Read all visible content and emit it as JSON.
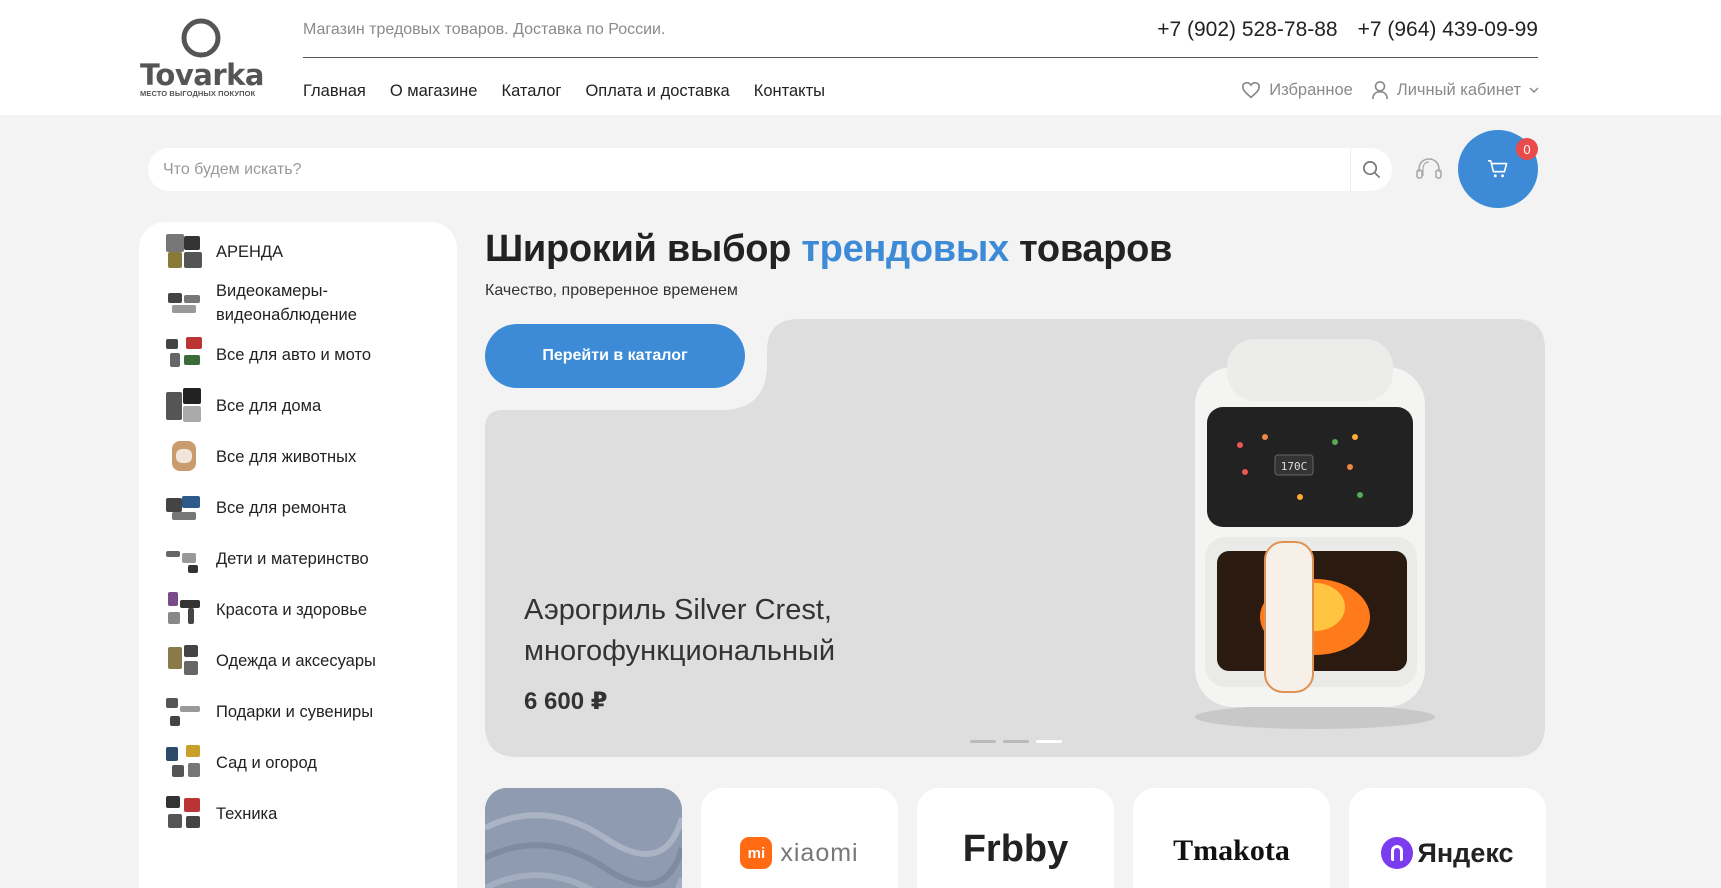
{
  "header": {
    "logo_text": "Tovarka",
    "logo_tagline": "МЕСТО ВЫГОДНЫХ ПОКУПОК",
    "tagline": "Магазин тредовых товаров. Доставка по России.",
    "phones": [
      "+7 (902) 528-78-88",
      "+7 (964) 439-09-99"
    ],
    "nav": [
      "Главная",
      "О магазине",
      "Каталог",
      "Оплата и доставка",
      "Контакты"
    ],
    "favorites_label": "Избранное",
    "account_label": "Личный кабинет"
  },
  "search": {
    "placeholder": "Что будем искать?"
  },
  "cart": {
    "count": "0"
  },
  "sidebar": {
    "categories": [
      "АРЕНДА",
      "Видеокамеры-видеонаблюдение",
      "Все для авто и мото",
      "Все для дома",
      "Все для животных",
      "Все для ремонта",
      "Дети и материнство",
      "Красота и здоровье",
      "Одежда и аксесуары",
      "Подарки и сувениры",
      "Сад и огород",
      "Техника"
    ]
  },
  "hero": {
    "title_part1": "Широкий выбор ",
    "title_accent": "трендовых",
    "title_part2": " товаров",
    "subtitle": "Качество, проверенное временем",
    "button_label": "Перейти в каталог"
  },
  "slide": {
    "product_name": "Аэрогриль Silver Crest, многофункциональный",
    "price": "6 600 ₽",
    "display_reading": "170C",
    "active_dot": 3,
    "dot_count": 3
  },
  "brands": [
    "xiaomi",
    "Frbby",
    "Tmakota",
    "Яндекс"
  ],
  "colors": {
    "accent": "#3d8bd6",
    "badge": "#e94b4b",
    "page_bg": "#f3f3f3",
    "banner_bg": "#dedede"
  }
}
